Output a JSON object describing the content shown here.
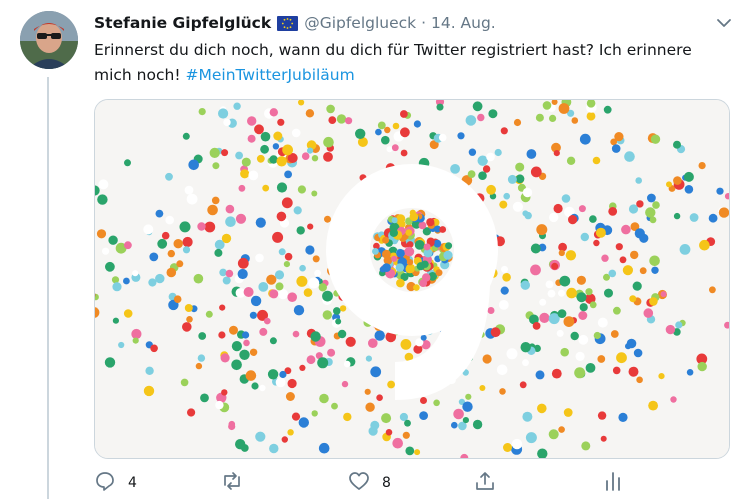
{
  "tweet": {
    "display_name": "Stefanie Gipfelglück",
    "handle": "@Gipfelglueck",
    "separator": "·",
    "date": "14. Aug.",
    "text": "Erinnerst du dich noch, wann du dich für Twitter registriert hast? Ich erinnere mich noch! ",
    "hashtag": "#MeinTwitterJubiläum",
    "media": {
      "figure_number": "9",
      "description_icon": "confetti-nine-image"
    },
    "actions": {
      "reply_count": "4",
      "retweet_count": "",
      "like_count": "8"
    }
  },
  "colors": {
    "name": "#14171a",
    "secondary": "#657786",
    "hashtag": "#1b95e0",
    "thread_line": "#ccd6dd",
    "confetti": [
      "#f5c518",
      "#e83a3a",
      "#2aa46b",
      "#2b7fd6",
      "#f08a24",
      "#ef6fa0",
      "#7ecfe0",
      "#9bd15a",
      "#ffffff"
    ]
  }
}
